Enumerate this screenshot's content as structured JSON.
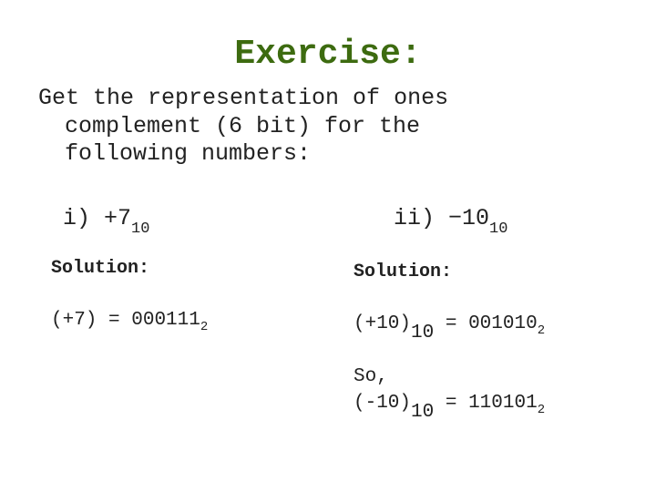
{
  "slide": {
    "title": "Exercise:",
    "prompt_lines": [
      "Get the representation of ones",
      "complement (6 bit) for the",
      "following numbers:"
    ],
    "colors": {
      "title": "#3d6b10",
      "text": "#222222",
      "background": "#ffffff"
    }
  },
  "problems": [
    {
      "label": "i) +7",
      "label_subscript": "10",
      "solution_heading": "Solution:",
      "steps": [
        {
          "lhs": "(+7)",
          "lhs_subscript": "",
          "equals": "=",
          "rhs": "000111",
          "rhs_subscript": "2"
        }
      ]
    },
    {
      "label": "ii) −10",
      "label_subscript": "10",
      "solution_heading": "Solution:",
      "steps": [
        {
          "lhs": "(+10)",
          "lhs_subscript": "10",
          "equals": "=",
          "rhs": "001010",
          "rhs_subscript": "2"
        }
      ],
      "conclusion_prefix": "So,",
      "conclusion": {
        "lhs": "(-10)",
        "lhs_subscript": "10",
        "equals": "=",
        "rhs": "110101",
        "rhs_subscript": "2"
      }
    }
  ]
}
